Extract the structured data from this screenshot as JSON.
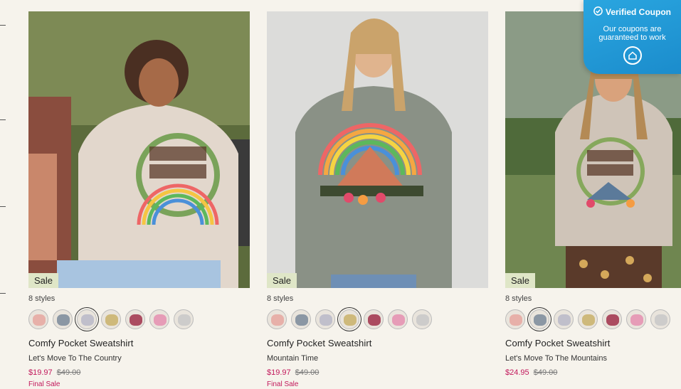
{
  "colors": {
    "accent": "#c2185b",
    "sale_badge": "#dfe6c7",
    "coupon_bg": "#1b8ccc"
  },
  "coupon": {
    "title": "Verified Coupon",
    "desc_line1": "Our coupons are",
    "desc_line2": "guaranteed to work",
    "icons": [
      "check-circle-icon",
      "coupon-house-icon"
    ]
  },
  "products": [
    {
      "sale": "Sale",
      "styles": "8 styles",
      "name": "Comfy Pocket Sweatshirt",
      "design": "Let's Move To The Country",
      "price": "$19.97",
      "was": "$49.00",
      "final": "Final Sale",
      "swatches": [
        "#e6a7a0",
        "#7a8a9a",
        "#b8b8c8",
        "#c9b26a",
        "#a0304a",
        "#e58fb0",
        "#c8c8c8"
      ],
      "selected": 2
    },
    {
      "sale": "Sale",
      "styles": "8 styles",
      "name": "Comfy Pocket Sweatshirt",
      "design": "Mountain Time",
      "price": "$19.97",
      "was": "$49.00",
      "final": "Final Sale",
      "swatches": [
        "#e6a7a0",
        "#7a8a9a",
        "#b8b8c8",
        "#c9b26a",
        "#a0304a",
        "#e58fb0",
        "#c8c8c8"
      ],
      "selected": 3
    },
    {
      "sale": "Sale",
      "styles": "8 styles",
      "name": "Comfy Pocket Sweatshirt",
      "design": "Let's Move To The Mountains",
      "price": "$24.95",
      "was": "$49.00",
      "final": "",
      "swatches": [
        "#e6a7a0",
        "#7a8a9a",
        "#b8b8c8",
        "#c9b26a",
        "#a0304a",
        "#e58fb0",
        "#c8c8c8"
      ],
      "selected": 1
    }
  ]
}
